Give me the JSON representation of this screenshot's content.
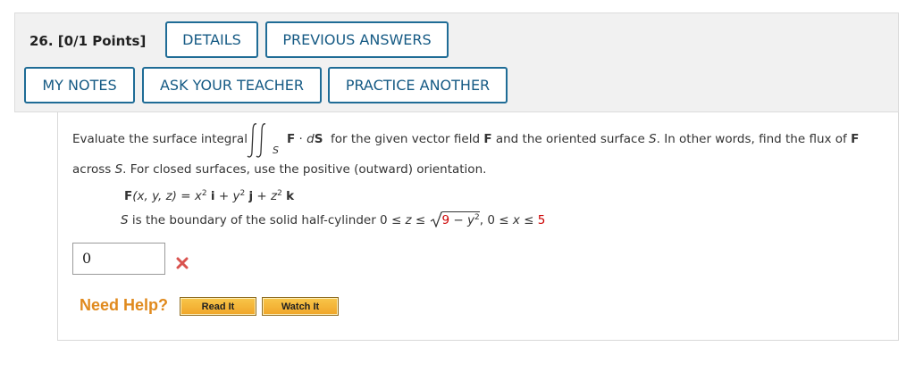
{
  "question": {
    "number_points": "26.  [0/1 Points]"
  },
  "buttons": {
    "details": "DETAILS",
    "previous_answers": "PREVIOUS ANSWERS",
    "my_notes": "MY NOTES",
    "ask_teacher": "ASK YOUR TEACHER",
    "practice_another": "PRACTICE ANOTHER"
  },
  "problem": {
    "intro": "Evaluate the surface integral",
    "integrand_F": "F",
    "integrand_dot": " · ",
    "integrand_d": "d",
    "integrand_S": "S",
    "integral_sub": "S",
    "line1_rest_a": "for the given vector field ",
    "line1_F": "F",
    "line1_rest_b": " and the oriented surface ",
    "line1_S": "S",
    "line1_rest_c": ". In other words, find the flux of ",
    "line1_F2": "F",
    "line2_a": "across ",
    "line2_S": "S",
    "line2_b": ". For closed surfaces, use the positive (outward) orientation.",
    "field": {
      "F": "F",
      "args": "(x, y, z)",
      "eq": " = ",
      "x": "x",
      "i": "i",
      "y": "y",
      "j": "j",
      "z": "z",
      "k": "k",
      "exp": "2",
      "plus": " + "
    },
    "surface": {
      "S": "S",
      "text": " is the boundary of the solid half-cylinder  0 ≤ ",
      "z": "z",
      "le": " ≤ ",
      "rad_9": "9",
      "rad_minus": " − ",
      "rad_y": "y",
      "rad_exp": "2",
      "tail_a": ", 0 ≤ ",
      "tail_x": "x",
      "tail_b": " ≤ ",
      "tail_5": "5"
    }
  },
  "answer": {
    "value": "0",
    "status": "incorrect",
    "status_icon": "x-mark-icon"
  },
  "help": {
    "label": "Need Help?",
    "read_it": "Read It",
    "watch_it": "Watch It"
  },
  "colors": {
    "button_border": "#1f6c96",
    "button_text": "#155a84",
    "incorrect": "#d9534f",
    "need_help": "#e08a1e",
    "highlight_value": "#cc0000"
  }
}
